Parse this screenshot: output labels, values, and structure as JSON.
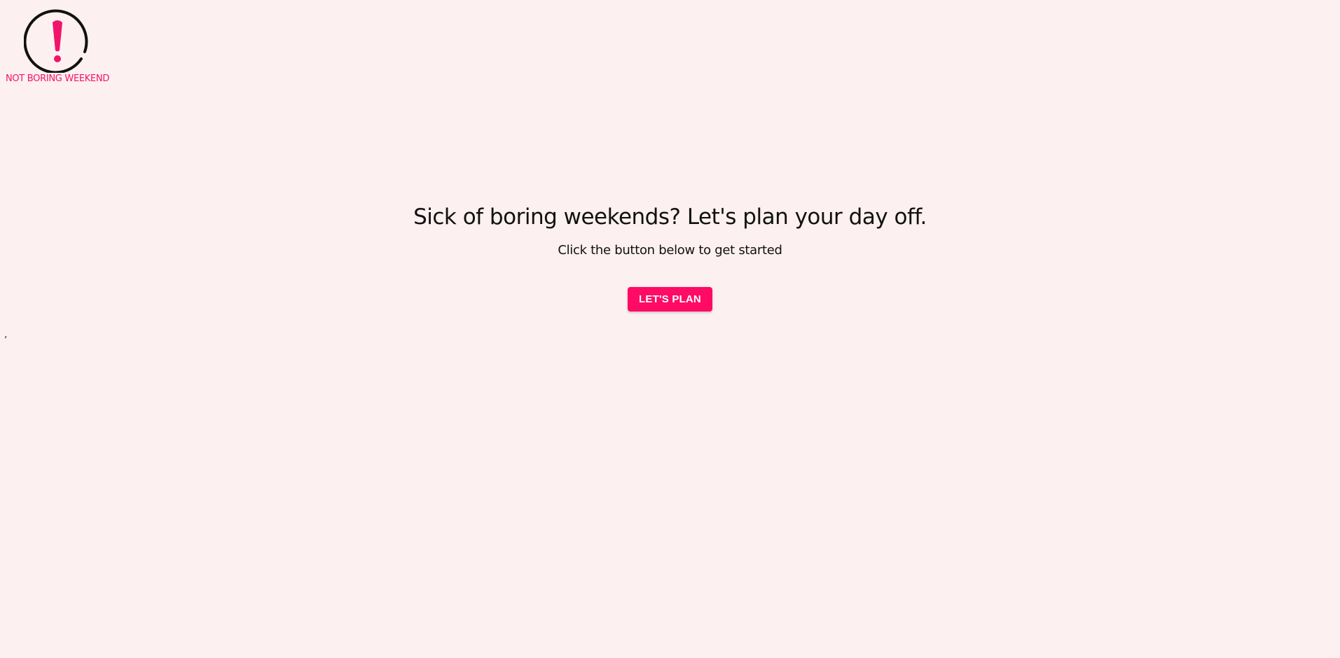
{
  "brand": {
    "name": "NOT BORING WEEKEND",
    "logo_icon": "exclamation-circle-icon",
    "accent_color": "#ff0a64"
  },
  "hero": {
    "title": "Sick of boring weekends? Let's plan your day off.",
    "subtitle": "Click the button below to get started",
    "cta_label": "LET'S PLAN"
  },
  "stray_text": ","
}
